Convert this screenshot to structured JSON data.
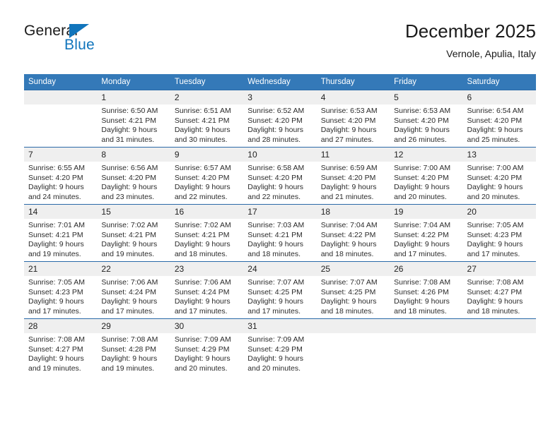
{
  "branding": {
    "logo_text_top": "General",
    "logo_text_bottom": "Blue",
    "accent_color": "#1175bc"
  },
  "header": {
    "title": "December 2025",
    "subtitle": "Vernole, Apulia, Italy"
  },
  "theme": {
    "header_row_bg": "#3479b8",
    "row_divider": "#2a6aa8",
    "daynum_bg": "#efefef",
    "page_bg": "#ffffff"
  },
  "calendar": {
    "weekday_headers": [
      "Sunday",
      "Monday",
      "Tuesday",
      "Wednesday",
      "Thursday",
      "Friday",
      "Saturday"
    ],
    "weeks": [
      [
        {
          "day": "",
          "sunrise": "",
          "sunset": "",
          "daylight_line1": "",
          "daylight_line2": "",
          "empty": true
        },
        {
          "day": "1",
          "sunrise": "Sunrise: 6:50 AM",
          "sunset": "Sunset: 4:21 PM",
          "daylight_line1": "Daylight: 9 hours",
          "daylight_line2": "and 31 minutes."
        },
        {
          "day": "2",
          "sunrise": "Sunrise: 6:51 AM",
          "sunset": "Sunset: 4:21 PM",
          "daylight_line1": "Daylight: 9 hours",
          "daylight_line2": "and 30 minutes."
        },
        {
          "day": "3",
          "sunrise": "Sunrise: 6:52 AM",
          "sunset": "Sunset: 4:20 PM",
          "daylight_line1": "Daylight: 9 hours",
          "daylight_line2": "and 28 minutes."
        },
        {
          "day": "4",
          "sunrise": "Sunrise: 6:53 AM",
          "sunset": "Sunset: 4:20 PM",
          "daylight_line1": "Daylight: 9 hours",
          "daylight_line2": "and 27 minutes."
        },
        {
          "day": "5",
          "sunrise": "Sunrise: 6:53 AM",
          "sunset": "Sunset: 4:20 PM",
          "daylight_line1": "Daylight: 9 hours",
          "daylight_line2": "and 26 minutes."
        },
        {
          "day": "6",
          "sunrise": "Sunrise: 6:54 AM",
          "sunset": "Sunset: 4:20 PM",
          "daylight_line1": "Daylight: 9 hours",
          "daylight_line2": "and 25 minutes."
        }
      ],
      [
        {
          "day": "7",
          "sunrise": "Sunrise: 6:55 AM",
          "sunset": "Sunset: 4:20 PM",
          "daylight_line1": "Daylight: 9 hours",
          "daylight_line2": "and 24 minutes."
        },
        {
          "day": "8",
          "sunrise": "Sunrise: 6:56 AM",
          "sunset": "Sunset: 4:20 PM",
          "daylight_line1": "Daylight: 9 hours",
          "daylight_line2": "and 23 minutes."
        },
        {
          "day": "9",
          "sunrise": "Sunrise: 6:57 AM",
          "sunset": "Sunset: 4:20 PM",
          "daylight_line1": "Daylight: 9 hours",
          "daylight_line2": "and 22 minutes."
        },
        {
          "day": "10",
          "sunrise": "Sunrise: 6:58 AM",
          "sunset": "Sunset: 4:20 PM",
          "daylight_line1": "Daylight: 9 hours",
          "daylight_line2": "and 22 minutes."
        },
        {
          "day": "11",
          "sunrise": "Sunrise: 6:59 AM",
          "sunset": "Sunset: 4:20 PM",
          "daylight_line1": "Daylight: 9 hours",
          "daylight_line2": "and 21 minutes."
        },
        {
          "day": "12",
          "sunrise": "Sunrise: 7:00 AM",
          "sunset": "Sunset: 4:20 PM",
          "daylight_line1": "Daylight: 9 hours",
          "daylight_line2": "and 20 minutes."
        },
        {
          "day": "13",
          "sunrise": "Sunrise: 7:00 AM",
          "sunset": "Sunset: 4:20 PM",
          "daylight_line1": "Daylight: 9 hours",
          "daylight_line2": "and 20 minutes."
        }
      ],
      [
        {
          "day": "14",
          "sunrise": "Sunrise: 7:01 AM",
          "sunset": "Sunset: 4:21 PM",
          "daylight_line1": "Daylight: 9 hours",
          "daylight_line2": "and 19 minutes."
        },
        {
          "day": "15",
          "sunrise": "Sunrise: 7:02 AM",
          "sunset": "Sunset: 4:21 PM",
          "daylight_line1": "Daylight: 9 hours",
          "daylight_line2": "and 19 minutes."
        },
        {
          "day": "16",
          "sunrise": "Sunrise: 7:02 AM",
          "sunset": "Sunset: 4:21 PM",
          "daylight_line1": "Daylight: 9 hours",
          "daylight_line2": "and 18 minutes."
        },
        {
          "day": "17",
          "sunrise": "Sunrise: 7:03 AM",
          "sunset": "Sunset: 4:21 PM",
          "daylight_line1": "Daylight: 9 hours",
          "daylight_line2": "and 18 minutes."
        },
        {
          "day": "18",
          "sunrise": "Sunrise: 7:04 AM",
          "sunset": "Sunset: 4:22 PM",
          "daylight_line1": "Daylight: 9 hours",
          "daylight_line2": "and 18 minutes."
        },
        {
          "day": "19",
          "sunrise": "Sunrise: 7:04 AM",
          "sunset": "Sunset: 4:22 PM",
          "daylight_line1": "Daylight: 9 hours",
          "daylight_line2": "and 17 minutes."
        },
        {
          "day": "20",
          "sunrise": "Sunrise: 7:05 AM",
          "sunset": "Sunset: 4:23 PM",
          "daylight_line1": "Daylight: 9 hours",
          "daylight_line2": "and 17 minutes."
        }
      ],
      [
        {
          "day": "21",
          "sunrise": "Sunrise: 7:05 AM",
          "sunset": "Sunset: 4:23 PM",
          "daylight_line1": "Daylight: 9 hours",
          "daylight_line2": "and 17 minutes."
        },
        {
          "day": "22",
          "sunrise": "Sunrise: 7:06 AM",
          "sunset": "Sunset: 4:24 PM",
          "daylight_line1": "Daylight: 9 hours",
          "daylight_line2": "and 17 minutes."
        },
        {
          "day": "23",
          "sunrise": "Sunrise: 7:06 AM",
          "sunset": "Sunset: 4:24 PM",
          "daylight_line1": "Daylight: 9 hours",
          "daylight_line2": "and 17 minutes."
        },
        {
          "day": "24",
          "sunrise": "Sunrise: 7:07 AM",
          "sunset": "Sunset: 4:25 PM",
          "daylight_line1": "Daylight: 9 hours",
          "daylight_line2": "and 17 minutes."
        },
        {
          "day": "25",
          "sunrise": "Sunrise: 7:07 AM",
          "sunset": "Sunset: 4:25 PM",
          "daylight_line1": "Daylight: 9 hours",
          "daylight_line2": "and 18 minutes."
        },
        {
          "day": "26",
          "sunrise": "Sunrise: 7:08 AM",
          "sunset": "Sunset: 4:26 PM",
          "daylight_line1": "Daylight: 9 hours",
          "daylight_line2": "and 18 minutes."
        },
        {
          "day": "27",
          "sunrise": "Sunrise: 7:08 AM",
          "sunset": "Sunset: 4:27 PM",
          "daylight_line1": "Daylight: 9 hours",
          "daylight_line2": "and 18 minutes."
        }
      ],
      [
        {
          "day": "28",
          "sunrise": "Sunrise: 7:08 AM",
          "sunset": "Sunset: 4:27 PM",
          "daylight_line1": "Daylight: 9 hours",
          "daylight_line2": "and 19 minutes."
        },
        {
          "day": "29",
          "sunrise": "Sunrise: 7:08 AM",
          "sunset": "Sunset: 4:28 PM",
          "daylight_line1": "Daylight: 9 hours",
          "daylight_line2": "and 19 minutes."
        },
        {
          "day": "30",
          "sunrise": "Sunrise: 7:09 AM",
          "sunset": "Sunset: 4:29 PM",
          "daylight_line1": "Daylight: 9 hours",
          "daylight_line2": "and 20 minutes."
        },
        {
          "day": "31",
          "sunrise": "Sunrise: 7:09 AM",
          "sunset": "Sunset: 4:29 PM",
          "daylight_line1": "Daylight: 9 hours",
          "daylight_line2": "and 20 minutes."
        },
        {
          "day": "",
          "sunrise": "",
          "sunset": "",
          "daylight_line1": "",
          "daylight_line2": "",
          "empty": true
        },
        {
          "day": "",
          "sunrise": "",
          "sunset": "",
          "daylight_line1": "",
          "daylight_line2": "",
          "empty": true
        },
        {
          "day": "",
          "sunrise": "",
          "sunset": "",
          "daylight_line1": "",
          "daylight_line2": "",
          "empty": true
        }
      ]
    ]
  }
}
